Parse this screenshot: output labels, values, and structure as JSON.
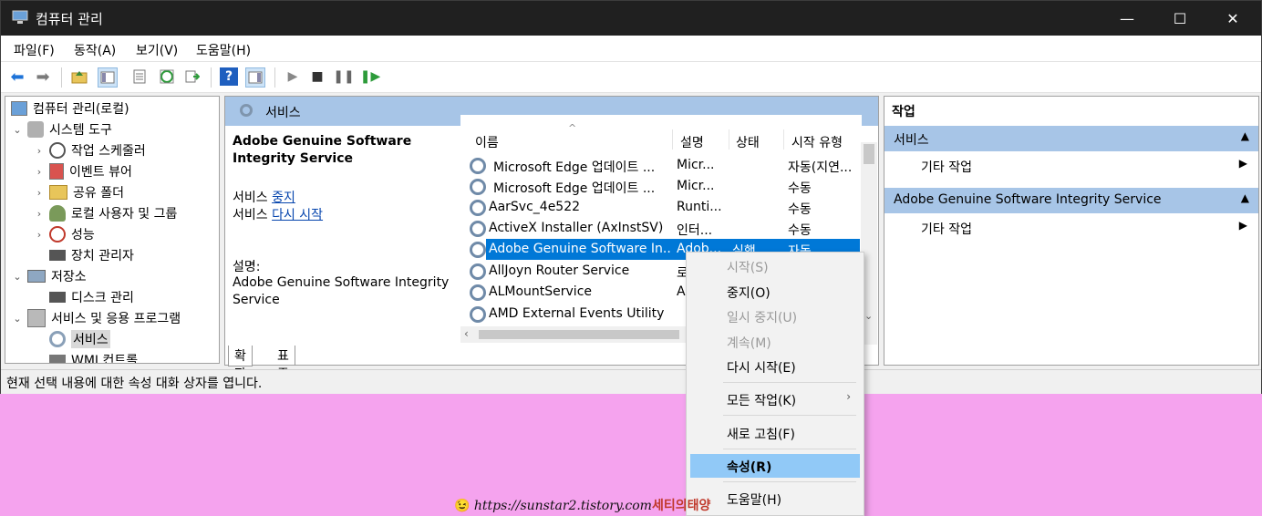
{
  "window": {
    "title": "컴퓨터 관리"
  },
  "window_controls": {
    "minimize": "—",
    "maximize": "☐",
    "close": "✕"
  },
  "menu": [
    "파일(F)",
    "동작(A)",
    "보기(V)",
    "도움말(H)"
  ],
  "tree": {
    "items": [
      {
        "label": "컴퓨터 관리(로컬)",
        "expander": "",
        "icon": "computer-management-icon"
      },
      {
        "label": "시스템 도구",
        "expander": "⌄",
        "icon": "tools-icon"
      },
      {
        "label": "작업 스케줄러",
        "expander": "›",
        "icon": "clock-icon"
      },
      {
        "label": "이벤트 뷰어",
        "expander": "›",
        "icon": "event-viewer-icon"
      },
      {
        "label": "공유 폴더",
        "expander": "›",
        "icon": "shared-folder-icon"
      },
      {
        "label": "로컬 사용자 및 그룹",
        "expander": "›",
        "icon": "users-icon"
      },
      {
        "label": "성능",
        "expander": "›",
        "icon": "performance-icon"
      },
      {
        "label": "장치 관리자",
        "expander": "",
        "icon": "device-manager-icon"
      },
      {
        "label": "저장소",
        "expander": "⌄",
        "icon": "storage-icon"
      },
      {
        "label": "디스크 관리",
        "expander": "",
        "icon": "disk-icon"
      },
      {
        "label": "서비스 및 응용 프로그램",
        "expander": "⌄",
        "icon": "services-apps-icon"
      },
      {
        "label": "서비스",
        "expander": "",
        "icon": "gear-icon"
      },
      {
        "label": "WMI 컨트롤",
        "expander": "",
        "icon": "wmi-icon"
      }
    ]
  },
  "center": {
    "header": "서비스",
    "selected_service_title": "Adobe Genuine Software Integrity Service",
    "stop_prefix": "서비스",
    "stop_link": "중지",
    "restart_prefix": "서비스",
    "restart_link": "다시 시작",
    "desc_label": "설명:",
    "desc_text": "Adobe Genuine Software Integrity Service",
    "columns": [
      "이름",
      "설명",
      "상태",
      "시작 유형"
    ],
    "sort_indicator": "^",
    "rows": [
      {
        "name": "Microsoft Edge 업데이트 ...",
        "desc": "Micr...",
        "status": "",
        "start": "자동(지연..."
      },
      {
        "name": "Microsoft Edge 업데이트 ...",
        "desc": "Micr...",
        "status": "",
        "start": "수동"
      },
      {
        "name": "AarSvc_4e522",
        "desc": "Runti...",
        "status": "",
        "start": "수동"
      },
      {
        "name": "ActiveX Installer (AxInstSV)",
        "desc": "인터...",
        "status": "",
        "start": "수동"
      },
      {
        "name": "Adobe Genuine Software In...",
        "desc": "Adob...",
        "status": "실행",
        "start": "자동"
      },
      {
        "name": "AllJoyn Router Service",
        "desc": "로",
        "status": "",
        "start": ""
      },
      {
        "name": "ALMountService",
        "desc": "A",
        "status": "",
        "start": ""
      },
      {
        "name": "AMD External Events Utility",
        "desc": "",
        "status": "",
        "start": ""
      }
    ],
    "tabs": [
      "확장",
      "표준"
    ]
  },
  "actions": {
    "title": "작업",
    "sections": [
      {
        "label": "서비스",
        "item": "기타 작업"
      },
      {
        "label": "Adobe Genuine Software Integrity Service",
        "item": "기타 작업"
      }
    ]
  },
  "status_text": "현재 선택 내용에 대한 속성 대화 상자를 엽니다.",
  "context_menu": {
    "items": [
      {
        "label": "시작(S)",
        "disabled": true
      },
      {
        "label": "중지(O)",
        "disabled": false
      },
      {
        "label": "일시 중지(U)",
        "disabled": true
      },
      {
        "label": "계속(M)",
        "disabled": true
      },
      {
        "label": "다시 시작(E)",
        "disabled": false
      },
      {
        "label": "모든 작업(K)",
        "disabled": false,
        "submenu": "›"
      },
      {
        "label": "새로 고침(F)",
        "disabled": false
      },
      {
        "label": "속성(R)",
        "disabled": false,
        "highlighted": true
      },
      {
        "label": "도움말(H)",
        "disabled": false
      }
    ]
  },
  "watermark": {
    "emoji": "😉",
    "url": "https://sunstar2.tistory.com",
    "name": "세티의태양"
  },
  "colors": {
    "background": "#f5a3ee",
    "titlebar": "#202020",
    "header_blue": "#a7c5e7",
    "selection": "#0078d7",
    "menu_highlight": "#91c9f7"
  }
}
